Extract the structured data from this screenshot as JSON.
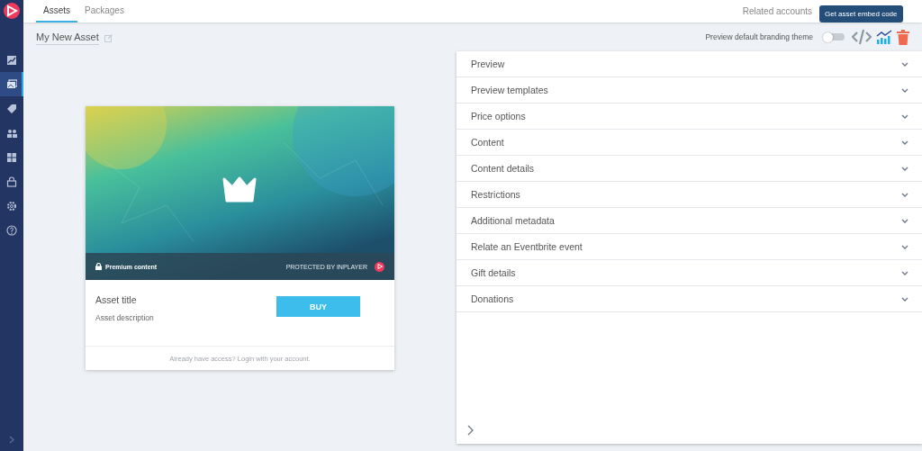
{
  "sidebar": {
    "items": [
      {
        "kind": "chart",
        "selected": false
      },
      {
        "kind": "images",
        "selected": true
      },
      {
        "kind": "tag",
        "selected": false
      },
      {
        "kind": "people",
        "selected": false
      },
      {
        "kind": "grid",
        "selected": false
      },
      {
        "kind": "lock",
        "selected": false
      },
      {
        "kind": "gear",
        "selected": false
      },
      {
        "kind": "help",
        "selected": false
      }
    ]
  },
  "tabs": [
    {
      "label": "Assets",
      "selected": true
    },
    {
      "label": "Packages",
      "selected": false
    }
  ],
  "related_accounts": "Related accounts",
  "asset_name": "My New Asset",
  "branding_toggle": {
    "label": "Preview default branding theme",
    "on": false
  },
  "tooltip": "Get asset embed code",
  "sections": [
    {
      "label": "Preview",
      "expanded": false
    },
    {
      "label": "Preview templates",
      "expanded": false
    },
    {
      "label": "Price options",
      "expanded": false
    },
    {
      "label": "Content",
      "expanded": false
    },
    {
      "label": "Content details",
      "expanded": false
    },
    {
      "label": "Restrictions",
      "expanded": false
    },
    {
      "label": "Additional metadata",
      "expanded": false
    },
    {
      "label": "Relate an Eventbrite event",
      "expanded": false
    },
    {
      "label": "Gift details",
      "expanded": false
    },
    {
      "label": "Donations",
      "expanded": false
    }
  ],
  "card": {
    "badge": "Premium content",
    "protected": "PROTECTED BY INPLAYER",
    "title": "Asset title",
    "description": "Asset description",
    "button": "BUY",
    "footer": "Already have access? Login with your account."
  }
}
